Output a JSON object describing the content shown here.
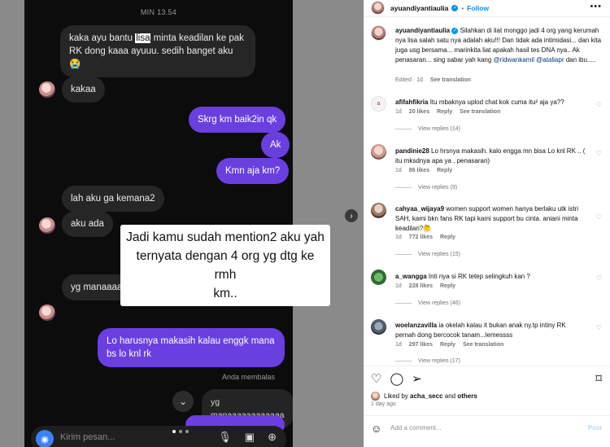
{
  "chat": {
    "time": "MIN 13.54",
    "msg1_pre": "kaka ayu bantu ",
    "msg1_hl": "lisa",
    "msg1_post": " minta keadilan ke pak RK dong kaaa ayuuu. sedih banget aku 😭",
    "msg2": "kakaa",
    "msg3": "Skrg km baik2in qk",
    "msg4": "Ak",
    "msg5": "Kmn aja km?",
    "msg6": "lah aku ga kemana2",
    "msg7": "aku ada",
    "msg8": "yg manaaaaaaaaaaaa",
    "msg9": "Lo harusnya makasih kalau enggk mana bs lo knl rk",
    "you_replied": "Anda membalas",
    "reply_quote": "yg manaaaaaaaaaaaa",
    "composer_placeholder": "Kirim pesan...",
    "caption_line1": "Jadi kamu sudah mention2 aku yah",
    "caption_line2": "ternyata dengan 4 org yg dtg ke rmh",
    "caption_line3": "km.."
  },
  "post": {
    "owner": "ayuandiyantiaulia",
    "follow_label": "Follow",
    "caption_text": "Silahkan di liat monggo jadi 4 org yang kerumah nya lisa salah satu nya adalah aku!!! Dan tidak ada intimidasi... dan kita juga usg bersama... marinkita liat apakah hasil tes DNA nya.. Ak penasaran... sing sabar yah kang ",
    "mention1": "@ridwankamil",
    "mention2": "@ataliapr",
    "caption_tail": " dan ibu.....",
    "caption_meta_time": "Edited · 1d",
    "see_translation": "See translation"
  },
  "comments": [
    {
      "user": "afifahfikria",
      "text": "Itu mbaknya uplod chat kok cuma itu² aja ya??",
      "time": "1d",
      "likes": "20 likes",
      "reply": "Reply",
      "translate": "See translation",
      "replies": "View replies (14)"
    },
    {
      "user": "pandinie28",
      "text": "Lo hrsnya makasih. kalo engga mn bisa Lo knl RK .. ( itu mksdnya apa ya , penasaran)",
      "time": "1d",
      "likes": "86 likes",
      "reply": "Reply",
      "translate": "",
      "replies": "View replies (9)"
    },
    {
      "user": "cahyaa_wijaya9",
      "text": "women support women hanya berlaku utk istri SAH, kami bkn fans RK tapi kami support bu cinta. aniani minta keadilan?🤔",
      "time": "1d",
      "likes": "772 likes",
      "reply": "Reply",
      "translate": "",
      "replies": "View replies (15)"
    },
    {
      "user": "a_wangga",
      "text": "Inti nya si RK tetep selingkuh kan ?",
      "time": "1d",
      "likes": "228 likes",
      "reply": "Reply",
      "translate": "",
      "replies": "View replies (46)"
    },
    {
      "user": "woelanzavilla",
      "text": "ia okelah kalau it bukan anak ny.tp intiny RK pernah dong bercocok tanam...lemessss",
      "time": "1d",
      "likes": "297 likes",
      "reply": "Reply",
      "translate": "See translation",
      "replies": "View replies (17)"
    }
  ],
  "footer": {
    "liked_by_prefix": "Liked by ",
    "liked_user": "acha_secc",
    "liked_and": " and ",
    "liked_others": "others",
    "ago": "1 day ago",
    "add_comment": "Add a comment...",
    "post_label": "Post"
  }
}
